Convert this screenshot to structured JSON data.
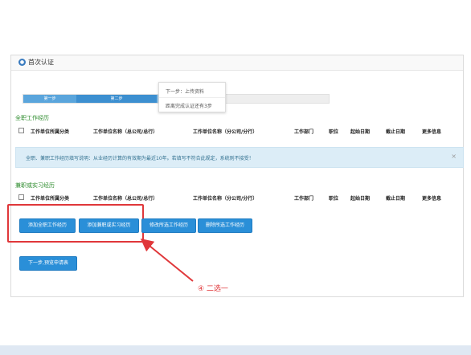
{
  "panel": {
    "title": "首次认证"
  },
  "steps": {
    "step1": "第一步",
    "step2": "第二步"
  },
  "tooltip": {
    "line1": "下一步：上传资料",
    "line2": "距离完成认证还有3步"
  },
  "fulltime": {
    "title": "全职工作经历",
    "columns": [
      "工作单位所属分类",
      "工作单位名称（总公司/总行）",
      "工作单位名称（分公司/分行）",
      "工作部门",
      "职位",
      "起始日期",
      "截止日期",
      "更多信息"
    ]
  },
  "notice": {
    "text": "全职、兼职工作经历填写说明：从业经历计算的有效期为最近10年。若填写不符合此规定，系统则不接受！",
    "close": "×"
  },
  "parttime": {
    "title": "兼职或实习经历",
    "columns": [
      "工作单位所属分类",
      "工作单位名称（总公司/总行）",
      "工作单位名称（分公司/分行）",
      "工作部门",
      "职位",
      "起始日期",
      "截止日期",
      "更多信息"
    ]
  },
  "buttons": {
    "add_fulltime": "添加全职工作经历",
    "add_parttime": "添加兼职或实习经历",
    "edit_selected": "修改所选工作经历",
    "delete_selected": "删除所选工作经历",
    "next": "下一步,预览申请表"
  },
  "annotation": {
    "text": "④ 二选一"
  },
  "colors": {
    "accent": "#2a8fd8",
    "highlight": "#e0373a",
    "section_title": "#2a8a2a"
  }
}
